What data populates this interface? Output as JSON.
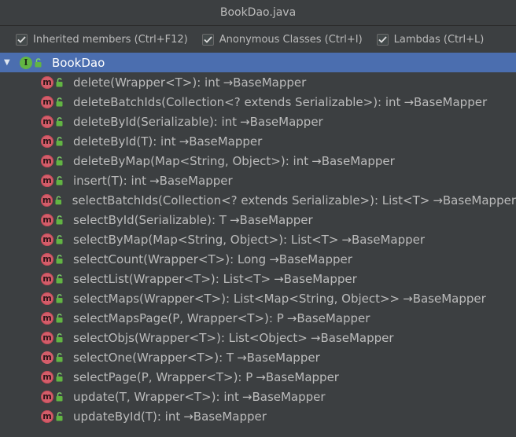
{
  "window": {
    "title": "BookDao.java"
  },
  "options": [
    {
      "label": "Inherited members (Ctrl+F12)",
      "checked": true
    },
    {
      "label": "Anonymous Classes (Ctrl+I)",
      "checked": true
    },
    {
      "label": "Lambdas (Ctrl+L)",
      "checked": true
    }
  ],
  "tree": {
    "root": {
      "label": "BookDao",
      "icon": "interface-icon",
      "icon_letter": "I"
    },
    "method_icon_letter": "m",
    "methods": [
      {
        "signature": "delete(Wrapper<T>): int",
        "origin": "BaseMapper",
        "inherited": true
      },
      {
        "signature": "deleteBatchIds(Collection<? extends Serializable>): int",
        "origin": "BaseMapper",
        "inherited": true
      },
      {
        "signature": "deleteById(Serializable): int",
        "origin": "BaseMapper",
        "inherited": true
      },
      {
        "signature": "deleteById(T): int",
        "origin": "BaseMapper",
        "inherited": true
      },
      {
        "signature": "deleteByMap(Map<String, Object>): int",
        "origin": "BaseMapper",
        "inherited": true
      },
      {
        "signature": "insert(T): int",
        "origin": "BaseMapper",
        "inherited": true
      },
      {
        "signature": "selectBatchIds(Collection<? extends Serializable>): List<T>",
        "origin": "BaseMapper",
        "inherited": true
      },
      {
        "signature": "selectById(Serializable): T",
        "origin": "BaseMapper",
        "inherited": true
      },
      {
        "signature": "selectByMap(Map<String, Object>): List<T>",
        "origin": "BaseMapper",
        "inherited": true
      },
      {
        "signature": "selectCount(Wrapper<T>): Long",
        "origin": "BaseMapper",
        "inherited": true
      },
      {
        "signature": "selectList(Wrapper<T>): List<T>",
        "origin": "BaseMapper",
        "inherited": true
      },
      {
        "signature": "selectMaps(Wrapper<T>): List<Map<String, Object>>",
        "origin": "BaseMapper",
        "inherited": true
      },
      {
        "signature": "selectMapsPage(P, Wrapper<T>): P",
        "origin": "BaseMapper",
        "inherited": true
      },
      {
        "signature": "selectObjs(Wrapper<T>): List<Object>",
        "origin": "BaseMapper",
        "inherited": true
      },
      {
        "signature": "selectOne(Wrapper<T>): T",
        "origin": "BaseMapper",
        "inherited": false
      },
      {
        "signature": "selectPage(P, Wrapper<T>): P",
        "origin": "BaseMapper",
        "inherited": true
      },
      {
        "signature": "update(T, Wrapper<T>): int",
        "origin": "BaseMapper",
        "inherited": true
      },
      {
        "signature": "updateById(T): int",
        "origin": "BaseMapper",
        "inherited": true
      }
    ]
  },
  "colors": {
    "background": "#3c3f41",
    "selection": "#4b6eaf",
    "method_icon": "#d45d6a",
    "interface_icon": "#62b543",
    "lock": "#62b543"
  }
}
